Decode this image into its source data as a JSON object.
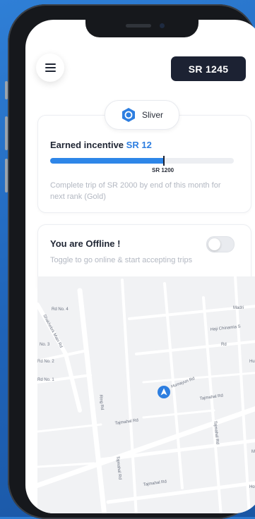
{
  "header": {
    "menu_icon": "hamburger-menu-icon",
    "balance": "SR 1245"
  },
  "rank": {
    "icon": "hexagon-badge-icon",
    "name": "Sliver"
  },
  "incentive": {
    "label": "Earned incentive",
    "amount": "SR 12",
    "progress": 0.62,
    "marker_label": "SR 1200",
    "note": "Complete trip of SR 2000 by end of this month for next rank (Gold)"
  },
  "status": {
    "title": "You are Offline !",
    "subtitle": "Toggle to go online & start accepting trips",
    "online": false
  },
  "map": {
    "labels": [
      "Rd No. 4",
      "Shakhebrk Main Rd",
      "No. 3",
      "Rd No. 2",
      "Rd No. 1",
      "Ring Rd",
      "Humayun Rd",
      "Tajmahal Rd",
      "Tajmahal Rd",
      "Tajmahal Rd",
      "Tajmahal Rd",
      "Tajmahal Rd",
      "Haji Chinamia S",
      "Madri",
      "Hu",
      "Ma",
      "Ho",
      "Rd"
    ],
    "location_icon": "navigation-arrow-icon"
  },
  "colors": {
    "accent": "#2d7ee0",
    "dark": "#1c2233",
    "muted": "#b3b8c2"
  }
}
